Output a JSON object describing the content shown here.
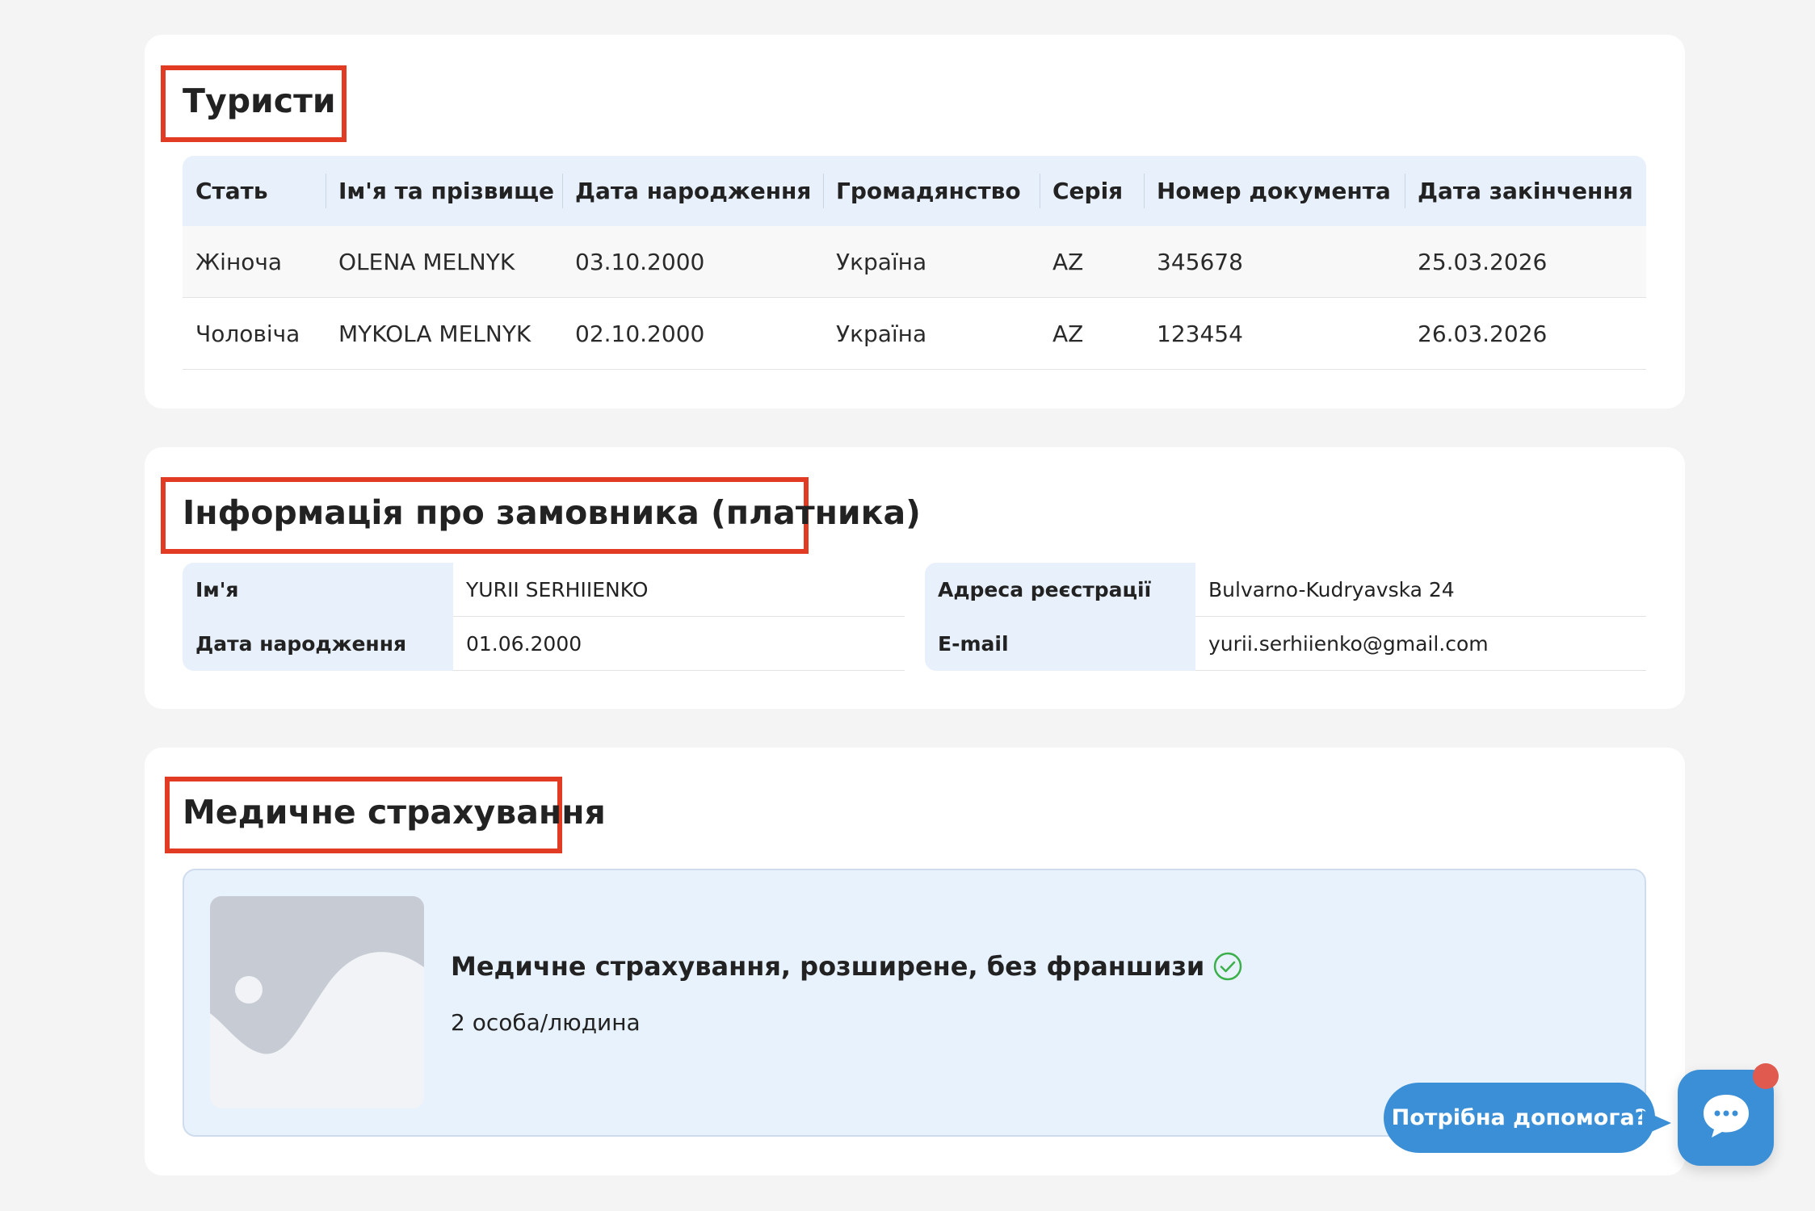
{
  "tourists": {
    "title": "Туристи",
    "columns": [
      "Стать",
      "Ім'я та прізвище",
      "Дата народження",
      "Громадянство",
      "Серія",
      "Номер документа",
      "Дата закінчення"
    ],
    "rows": [
      [
        "Жіноча",
        "OLENA MELNYK",
        "03.10.2000",
        "Україна",
        "AZ",
        "345678",
        "25.03.2026"
      ],
      [
        "Чоловіча",
        "MYKOLA MELNYK",
        "02.10.2000",
        "Україна",
        "AZ",
        "123454",
        "26.03.2026"
      ]
    ]
  },
  "payer": {
    "title": "Інформація про замовника (платника)",
    "left": [
      {
        "label": "Ім'я",
        "value": "YURII SERHIIENKO"
      },
      {
        "label": "Дата народження",
        "value": "01.06.2000"
      }
    ],
    "right": [
      {
        "label": "Адреса реєстрації",
        "value": "Bulvarno-Kudryavska 24"
      },
      {
        "label": "E-mail",
        "value": "yurii.serhiienko@gmail.com"
      }
    ]
  },
  "insurance": {
    "title": "Медичне страхування",
    "product_name": "Медичне страхування, розширене, без франшизи",
    "product_persons": "2 особа/людина",
    "status_icon": "check-circle-icon"
  },
  "help": {
    "label": "Потрібна допомога?",
    "chat_icon": "chat-bubble-icon",
    "badge_color": "#e05a50"
  },
  "colors": {
    "accent": "#3a8fd6",
    "highlight": "#e23b23",
    "header_bg": "#e8f1fb",
    "success": "#3bb04a"
  }
}
